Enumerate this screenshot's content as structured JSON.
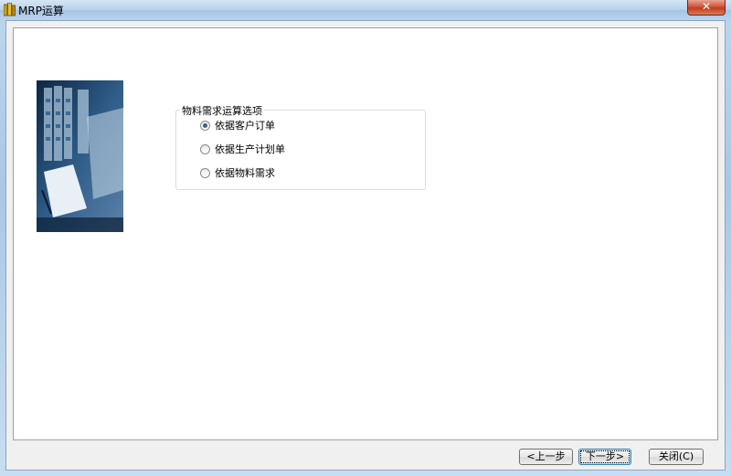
{
  "window": {
    "title": "MRP运算",
    "close_label": "✕"
  },
  "groupbox": {
    "legend": "物料需求运算选项",
    "options": [
      {
        "label": "依据客户订单",
        "checked": true
      },
      {
        "label": "依据生产计划单",
        "checked": false
      },
      {
        "label": "依据物料需求",
        "checked": false
      }
    ]
  },
  "buttons": {
    "prev": "<上一步",
    "next": "下一步>",
    "close": "关闭(C)"
  }
}
